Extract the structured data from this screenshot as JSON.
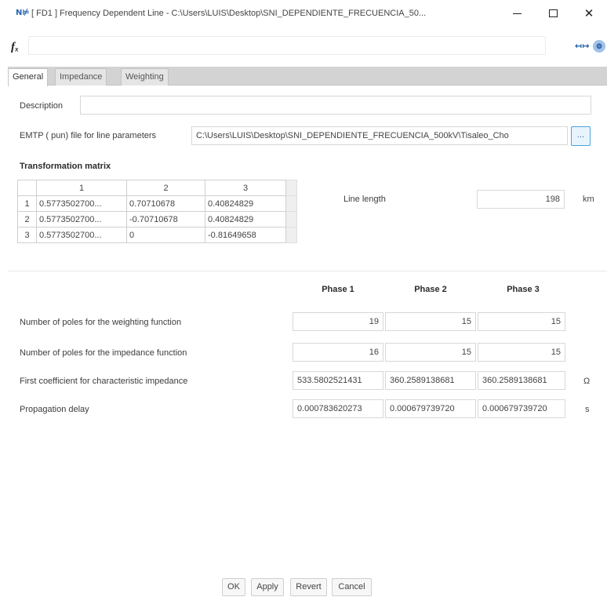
{
  "window": {
    "app_badge": "N⊭",
    "title": "[ FD1 ] Frequency Dependent Line - C:\\Users\\LUIS\\Desktop\\SNI_DEPENDIENTE_FRECUENCIA_50...",
    "minimize_icon": "minimize-icon",
    "maximize_icon": "maximize-icon",
    "close_symbol": "✕"
  },
  "formula_bar": {
    "fx_symbol": "fₓ",
    "value": "",
    "button1_symbol": "↤↦",
    "button2_symbol": "⚙"
  },
  "tabs": [
    {
      "label": "General",
      "active": true
    },
    {
      "label": "Impedance",
      "active": false
    },
    {
      "label": "Weighting",
      "active": false
    }
  ],
  "general": {
    "description_label": "Description",
    "description_value": "",
    "emtp_label": "EMTP ( pun) file for line parameters",
    "emtp_value": "C:\\Users\\LUIS\\Desktop\\SNI_DEPENDIENTE_FRECUENCIA_500kV\\Tisaleo_Cho",
    "browse_label": "...",
    "transformation_title": "Transformation matrix",
    "matrix": {
      "headers": [
        "1",
        "2",
        "3"
      ],
      "rows": [
        {
          "index": "1",
          "cells": [
            "0.5773502700...",
            "0.70710678",
            "0.40824829"
          ]
        },
        {
          "index": "2",
          "cells": [
            "0.5773502700...",
            "-0.70710678",
            "0.40824829"
          ]
        },
        {
          "index": "3",
          "cells": [
            "0.5773502700...",
            "0",
            "-0.81649658"
          ]
        }
      ]
    },
    "line_length_label": "Line length",
    "line_length_value": "198",
    "line_length_unit": "km",
    "phase_headers": [
      "Phase 1",
      "Phase 2",
      "Phase 3"
    ],
    "parameters": [
      {
        "label": "Number of poles for the weighting function",
        "values": [
          "19",
          "15",
          "15"
        ],
        "unit": ""
      },
      {
        "label": "Number of poles for the impedance function",
        "values": [
          "16",
          "15",
          "15"
        ],
        "unit": ""
      },
      {
        "label": "First coefficient for characteristic impedance",
        "values": [
          "533.5802521431",
          "360.2589138681",
          "360.2589138681"
        ],
        "unit": "Ω"
      },
      {
        "label": "Propagation delay",
        "values": [
          "0.000783620273",
          "0.000679739720",
          "0.000679739720"
        ],
        "unit": "s"
      }
    ]
  },
  "buttons": {
    "ok": "OK",
    "apply": "Apply",
    "revert": "Revert",
    "cancel": "Cancel"
  },
  "colors": {
    "accent": "#4aa3d8",
    "tab_bar": "#d3d3d3"
  }
}
